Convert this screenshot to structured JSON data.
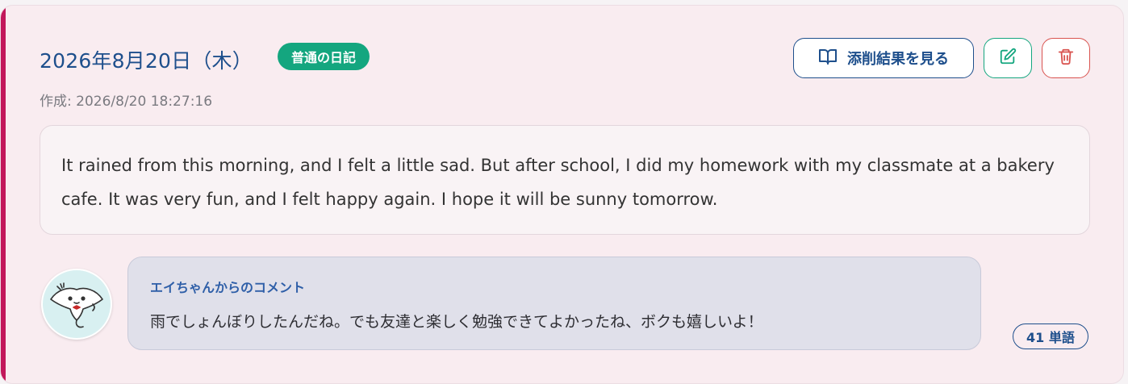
{
  "entry": {
    "date": "2026年8月20日（木）",
    "type_badge": "普通の日記",
    "created": "作成: 2026/8/20 18:27:16",
    "body": "It rained from this morning, and I felt a little sad. But after school, I did my homework with my classmate at a bakery cafe. It was very fun, and I felt happy again. I hope it will be sunny tomorrow.",
    "word_count": "41 単語"
  },
  "actions": {
    "review_label": "添削結果を見る",
    "review_icon": "book-open-icon",
    "edit_icon": "edit-icon",
    "delete_icon": "trash-icon"
  },
  "comment": {
    "author": "エイちゃんからのコメント",
    "text": "雨でしょんぼりしたんだね。でも友達と楽しく勉強できてよかったね、ボクも嬉しいよ！",
    "avatar_icon": "manta-ray-mascot-icon"
  },
  "colors": {
    "accent": "#c2185b",
    "primary": "#1e4f8c",
    "badge": "#14a67f",
    "danger": "#d9534f"
  }
}
